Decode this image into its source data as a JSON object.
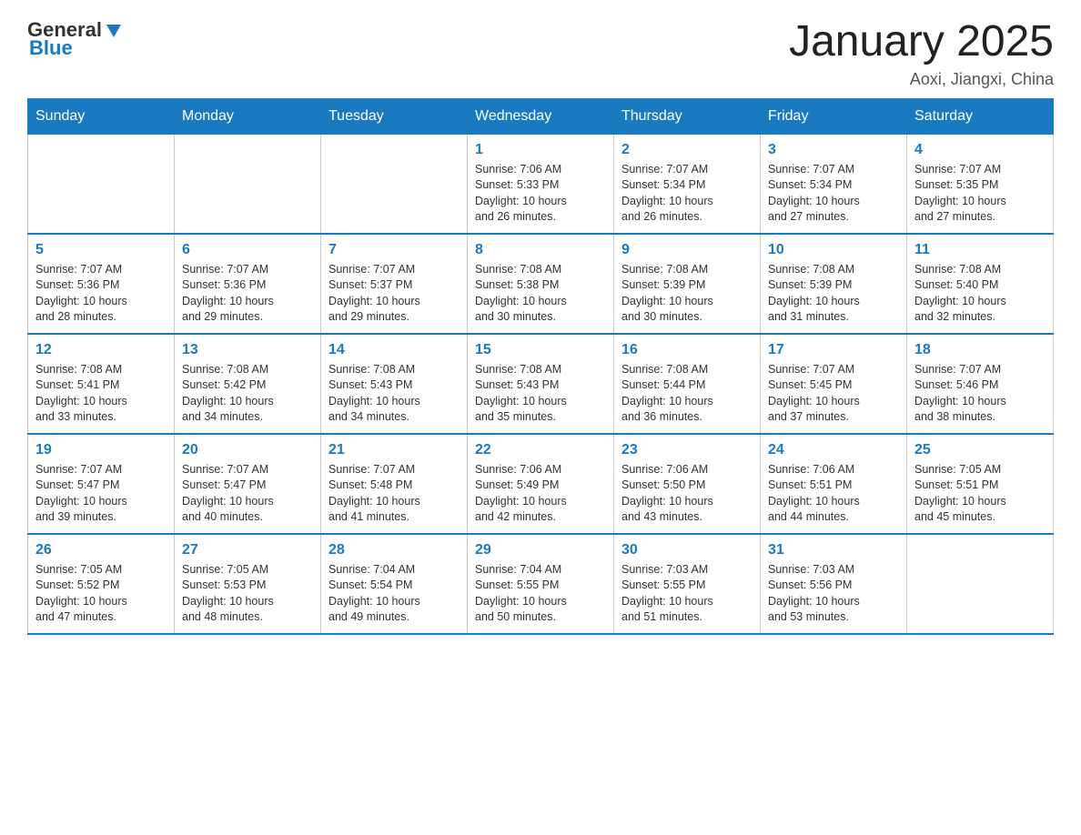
{
  "logo": {
    "general": "General",
    "blue": "Blue"
  },
  "title": "January 2025",
  "subtitle": "Aoxi, Jiangxi, China",
  "headers": [
    "Sunday",
    "Monday",
    "Tuesday",
    "Wednesday",
    "Thursday",
    "Friday",
    "Saturday"
  ],
  "weeks": [
    [
      {
        "day": "",
        "info": ""
      },
      {
        "day": "",
        "info": ""
      },
      {
        "day": "",
        "info": ""
      },
      {
        "day": "1",
        "info": "Sunrise: 7:06 AM\nSunset: 5:33 PM\nDaylight: 10 hours\nand 26 minutes."
      },
      {
        "day": "2",
        "info": "Sunrise: 7:07 AM\nSunset: 5:34 PM\nDaylight: 10 hours\nand 26 minutes."
      },
      {
        "day": "3",
        "info": "Sunrise: 7:07 AM\nSunset: 5:34 PM\nDaylight: 10 hours\nand 27 minutes."
      },
      {
        "day": "4",
        "info": "Sunrise: 7:07 AM\nSunset: 5:35 PM\nDaylight: 10 hours\nand 27 minutes."
      }
    ],
    [
      {
        "day": "5",
        "info": "Sunrise: 7:07 AM\nSunset: 5:36 PM\nDaylight: 10 hours\nand 28 minutes."
      },
      {
        "day": "6",
        "info": "Sunrise: 7:07 AM\nSunset: 5:36 PM\nDaylight: 10 hours\nand 29 minutes."
      },
      {
        "day": "7",
        "info": "Sunrise: 7:07 AM\nSunset: 5:37 PM\nDaylight: 10 hours\nand 29 minutes."
      },
      {
        "day": "8",
        "info": "Sunrise: 7:08 AM\nSunset: 5:38 PM\nDaylight: 10 hours\nand 30 minutes."
      },
      {
        "day": "9",
        "info": "Sunrise: 7:08 AM\nSunset: 5:39 PM\nDaylight: 10 hours\nand 30 minutes."
      },
      {
        "day": "10",
        "info": "Sunrise: 7:08 AM\nSunset: 5:39 PM\nDaylight: 10 hours\nand 31 minutes."
      },
      {
        "day": "11",
        "info": "Sunrise: 7:08 AM\nSunset: 5:40 PM\nDaylight: 10 hours\nand 32 minutes."
      }
    ],
    [
      {
        "day": "12",
        "info": "Sunrise: 7:08 AM\nSunset: 5:41 PM\nDaylight: 10 hours\nand 33 minutes."
      },
      {
        "day": "13",
        "info": "Sunrise: 7:08 AM\nSunset: 5:42 PM\nDaylight: 10 hours\nand 34 minutes."
      },
      {
        "day": "14",
        "info": "Sunrise: 7:08 AM\nSunset: 5:43 PM\nDaylight: 10 hours\nand 34 minutes."
      },
      {
        "day": "15",
        "info": "Sunrise: 7:08 AM\nSunset: 5:43 PM\nDaylight: 10 hours\nand 35 minutes."
      },
      {
        "day": "16",
        "info": "Sunrise: 7:08 AM\nSunset: 5:44 PM\nDaylight: 10 hours\nand 36 minutes."
      },
      {
        "day": "17",
        "info": "Sunrise: 7:07 AM\nSunset: 5:45 PM\nDaylight: 10 hours\nand 37 minutes."
      },
      {
        "day": "18",
        "info": "Sunrise: 7:07 AM\nSunset: 5:46 PM\nDaylight: 10 hours\nand 38 minutes."
      }
    ],
    [
      {
        "day": "19",
        "info": "Sunrise: 7:07 AM\nSunset: 5:47 PM\nDaylight: 10 hours\nand 39 minutes."
      },
      {
        "day": "20",
        "info": "Sunrise: 7:07 AM\nSunset: 5:47 PM\nDaylight: 10 hours\nand 40 minutes."
      },
      {
        "day": "21",
        "info": "Sunrise: 7:07 AM\nSunset: 5:48 PM\nDaylight: 10 hours\nand 41 minutes."
      },
      {
        "day": "22",
        "info": "Sunrise: 7:06 AM\nSunset: 5:49 PM\nDaylight: 10 hours\nand 42 minutes."
      },
      {
        "day": "23",
        "info": "Sunrise: 7:06 AM\nSunset: 5:50 PM\nDaylight: 10 hours\nand 43 minutes."
      },
      {
        "day": "24",
        "info": "Sunrise: 7:06 AM\nSunset: 5:51 PM\nDaylight: 10 hours\nand 44 minutes."
      },
      {
        "day": "25",
        "info": "Sunrise: 7:05 AM\nSunset: 5:51 PM\nDaylight: 10 hours\nand 45 minutes."
      }
    ],
    [
      {
        "day": "26",
        "info": "Sunrise: 7:05 AM\nSunset: 5:52 PM\nDaylight: 10 hours\nand 47 minutes."
      },
      {
        "day": "27",
        "info": "Sunrise: 7:05 AM\nSunset: 5:53 PM\nDaylight: 10 hours\nand 48 minutes."
      },
      {
        "day": "28",
        "info": "Sunrise: 7:04 AM\nSunset: 5:54 PM\nDaylight: 10 hours\nand 49 minutes."
      },
      {
        "day": "29",
        "info": "Sunrise: 7:04 AM\nSunset: 5:55 PM\nDaylight: 10 hours\nand 50 minutes."
      },
      {
        "day": "30",
        "info": "Sunrise: 7:03 AM\nSunset: 5:55 PM\nDaylight: 10 hours\nand 51 minutes."
      },
      {
        "day": "31",
        "info": "Sunrise: 7:03 AM\nSunset: 5:56 PM\nDaylight: 10 hours\nand 53 minutes."
      },
      {
        "day": "",
        "info": ""
      }
    ]
  ]
}
